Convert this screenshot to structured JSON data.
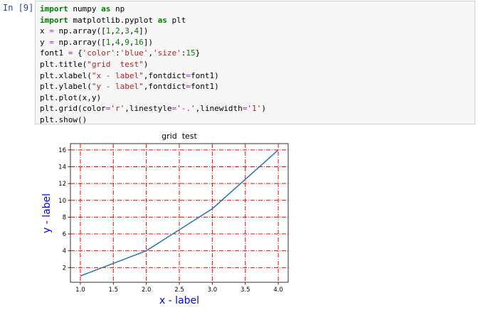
{
  "cell": {
    "prompt": "In [9]:",
    "lines": [
      [
        {
          "t": "import",
          "c": "kw"
        },
        {
          "t": " numpy "
        },
        {
          "t": "as",
          "c": "kw"
        },
        {
          "t": " np"
        }
      ],
      [
        {
          "t": "import",
          "c": "kw"
        },
        {
          "t": " matplotlib.pyplot "
        },
        {
          "t": "as",
          "c": "kw"
        },
        {
          "t": " plt"
        }
      ],
      [
        {
          "t": "x "
        },
        {
          "t": "=",
          "c": "op"
        },
        {
          "t": " np.array(["
        },
        {
          "t": "1",
          "c": "num"
        },
        {
          "t": ","
        },
        {
          "t": "2",
          "c": "num"
        },
        {
          "t": ","
        },
        {
          "t": "3",
          "c": "num"
        },
        {
          "t": ","
        },
        {
          "t": "4",
          "c": "num"
        },
        {
          "t": "])"
        }
      ],
      [
        {
          "t": "y "
        },
        {
          "t": "=",
          "c": "op"
        },
        {
          "t": " np.array(["
        },
        {
          "t": "1",
          "c": "num"
        },
        {
          "t": ","
        },
        {
          "t": "4",
          "c": "num"
        },
        {
          "t": ","
        },
        {
          "t": "9",
          "c": "num"
        },
        {
          "t": ","
        },
        {
          "t": "16",
          "c": "num"
        },
        {
          "t": "])"
        }
      ],
      [
        {
          "t": "font1 "
        },
        {
          "t": "=",
          "c": "op"
        },
        {
          "t": " {"
        },
        {
          "t": "'color'",
          "c": "str"
        },
        {
          "t": ":"
        },
        {
          "t": "'blue'",
          "c": "str"
        },
        {
          "t": ","
        },
        {
          "t": "'size'",
          "c": "str"
        },
        {
          "t": ":"
        },
        {
          "t": "15",
          "c": "num"
        },
        {
          "t": "}"
        }
      ],
      [
        {
          "t": "plt.title("
        },
        {
          "t": "\"grid  test\"",
          "c": "str"
        },
        {
          "t": ")"
        }
      ],
      [
        {
          "t": "plt.xlabel("
        },
        {
          "t": "\"x - label\"",
          "c": "str"
        },
        {
          "t": ",fontdict"
        },
        {
          "t": "=",
          "c": "op"
        },
        {
          "t": "font1)"
        }
      ],
      [
        {
          "t": "plt.ylabel("
        },
        {
          "t": "\"y - label\"",
          "c": "str"
        },
        {
          "t": ",fontdict"
        },
        {
          "t": "=",
          "c": "op"
        },
        {
          "t": "font1)"
        }
      ],
      [
        {
          "t": "plt.plot(x,y)"
        }
      ],
      [
        {
          "t": "plt.grid(color"
        },
        {
          "t": "=",
          "c": "op"
        },
        {
          "t": "'r'",
          "c": "str"
        },
        {
          "t": ",linestyle"
        },
        {
          "t": "=",
          "c": "op"
        },
        {
          "t": "'-.'",
          "c": "str"
        },
        {
          "t": ",linewidth"
        },
        {
          "t": "=",
          "c": "op"
        },
        {
          "t": "'1'",
          "c": "str"
        },
        {
          "t": ")"
        }
      ],
      [
        {
          "t": "plt.show()"
        }
      ]
    ]
  },
  "chart_data": {
    "type": "line",
    "title": "grid  test",
    "xlabel": "x - label",
    "ylabel": "y - label",
    "x": [
      1,
      2,
      3,
      4
    ],
    "series": [
      {
        "values": [
          1,
          4,
          9,
          16
        ],
        "color": "#1f77b4"
      }
    ],
    "xlim": [
      0.85,
      4.15
    ],
    "ylim": [
      0.25,
      16.75
    ],
    "xticks": [
      "1.0",
      "1.5",
      "2.0",
      "2.5",
      "3.0",
      "3.5",
      "4.0"
    ],
    "yticks": [
      "2",
      "4",
      "6",
      "8",
      "10",
      "12",
      "14",
      "16"
    ],
    "grid": true,
    "grid_color": "#ff0000",
    "grid_style": "-.",
    "label_color": "#0000ff"
  }
}
